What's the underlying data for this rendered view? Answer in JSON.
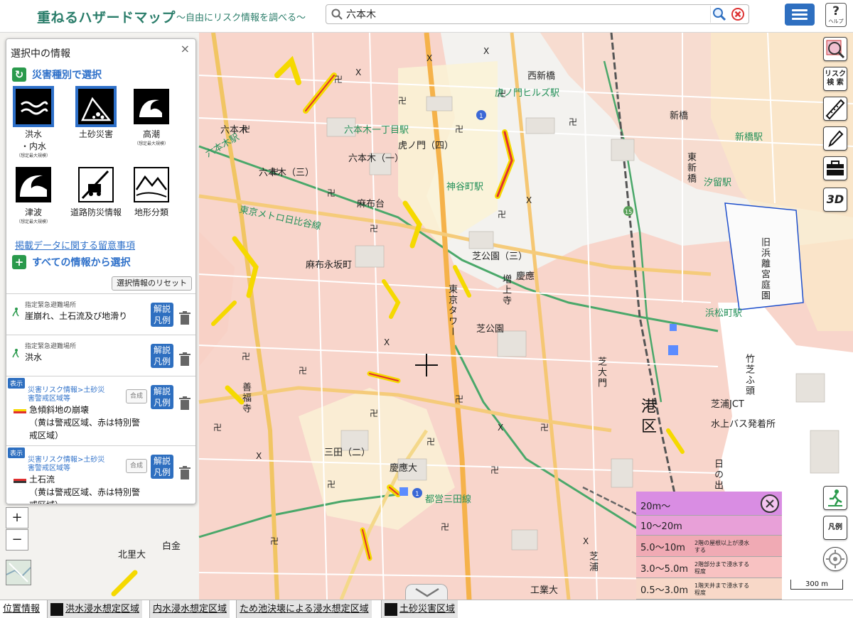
{
  "header": {
    "title": "重ねるハザードマップ",
    "subtitle": "〜自由にリスク情報を調べる〜",
    "search_value": "六本木",
    "help_label": "ヘルプ"
  },
  "panel": {
    "title": "選択中の情報",
    "close": "×",
    "by_type": "災害種別で選択",
    "hazards": [
      {
        "name": "洪水\n・内水",
        "note": "（想定最大規模）"
      },
      {
        "name": "土砂災害",
        "note": ""
      },
      {
        "name": "高潮",
        "note": "（想定最大規模）"
      },
      {
        "name": "津波",
        "note": "（想定最大規模）"
      },
      {
        "name": "道路防災情報",
        "note": ""
      },
      {
        "name": "地形分類",
        "note": ""
      }
    ],
    "notice_link": "掲載データに関する留意事項",
    "all_info": "すべての情報から選択",
    "reset_button": "選択情報のリセット",
    "layers": [
      {
        "category": "指定緊急避難場所",
        "name": "崖崩れ、土石流及び地滑り",
        "explain": "解説\n凡例"
      },
      {
        "category": "指定緊急避難場所",
        "name": "洪水",
        "explain": "解説\n凡例"
      },
      {
        "show": "表示",
        "category": "災害リスク情報>土砂災害警戒区域等",
        "name": "急傾斜地の崩壊\n（黄は警戒区域、赤は特別警戒区域）",
        "merge": "合成",
        "explain": "解説\n凡例"
      },
      {
        "show": "表示",
        "category": "災害リスク情報>土砂災害警戒区域等",
        "name": "土石流\n（黄は警戒区域、赤は特別警戒区域）",
        "merge": "合成",
        "explain": "解説\n凡例"
      }
    ]
  },
  "tools": {
    "risk_search": "リスク\n検 索",
    "three_d": "3D",
    "legend_button": "凡例"
  },
  "zoom": {
    "in": "+",
    "out": "−"
  },
  "legend": {
    "rows": [
      {
        "level": "20m〜",
        "note": "",
        "color": "#d98de3"
      },
      {
        "level": "10〜20m",
        "note": "",
        "color": "#e8a0d8"
      },
      {
        "level": "5.0〜10m",
        "note": "2階の屋根以上が浸水する",
        "color": "#f0aab4"
      },
      {
        "level": "3.0〜5.0m",
        "note": "2階部分まで浸水する程度",
        "color": "#f8c2c2"
      },
      {
        "level": "0.5〜3.0m",
        "note": "1階天井まで浸水する程度",
        "color": "#f8d8c8"
      }
    ]
  },
  "scale": "300 m",
  "bottom_tabs": [
    {
      "label": "位置情報",
      "icon": false
    },
    {
      "label": "洪水浸水想定区域",
      "icon": true
    },
    {
      "label": "内水浸水想定区域",
      "icon": false
    },
    {
      "label": "ため池決壊による浸水想定区域",
      "icon": false
    },
    {
      "label": "土砂災害区域",
      "icon": true
    }
  ],
  "map_labels": [
    {
      "t": "六本木"
    },
    {
      "t": "六本木駅"
    },
    {
      "t": "六本木（三）"
    },
    {
      "t": "六本木（一）"
    },
    {
      "t": "六本木一丁目駅"
    },
    {
      "t": "虎ノ門（四）"
    },
    {
      "t": "虎ノ門ヒルズ駅"
    },
    {
      "t": "西新橋"
    },
    {
      "t": "新橋"
    },
    {
      "t": "新橋駅"
    },
    {
      "t": "汐留駅"
    },
    {
      "t": "東新橋"
    },
    {
      "t": "神谷町駅"
    },
    {
      "t": "東京メトロ日比谷線"
    },
    {
      "t": "麻布永坂町"
    },
    {
      "t": "麻布台"
    },
    {
      "t": "芝公園（三）"
    },
    {
      "t": "慶應"
    },
    {
      "t": "増上寺"
    },
    {
      "t": "東京タワー"
    },
    {
      "t": "芝公園"
    },
    {
      "t": "浜松町駅"
    },
    {
      "t": "旧浜離宮庭園"
    },
    {
      "t": "港区"
    },
    {
      "t": "三田（二）"
    },
    {
      "t": "慶應大"
    },
    {
      "t": "都営三田線"
    },
    {
      "t": "芝浦"
    },
    {
      "t": "工業大"
    },
    {
      "t": "北里大"
    },
    {
      "t": "白金"
    },
    {
      "t": "善福寺"
    },
    {
      "t": "水上バス発着所"
    },
    {
      "t": "竹芝ふ頭"
    },
    {
      "t": "芝大門"
    },
    {
      "t": "芝浦JCT"
    },
    {
      "t": "日の出ふ頭"
    }
  ]
}
